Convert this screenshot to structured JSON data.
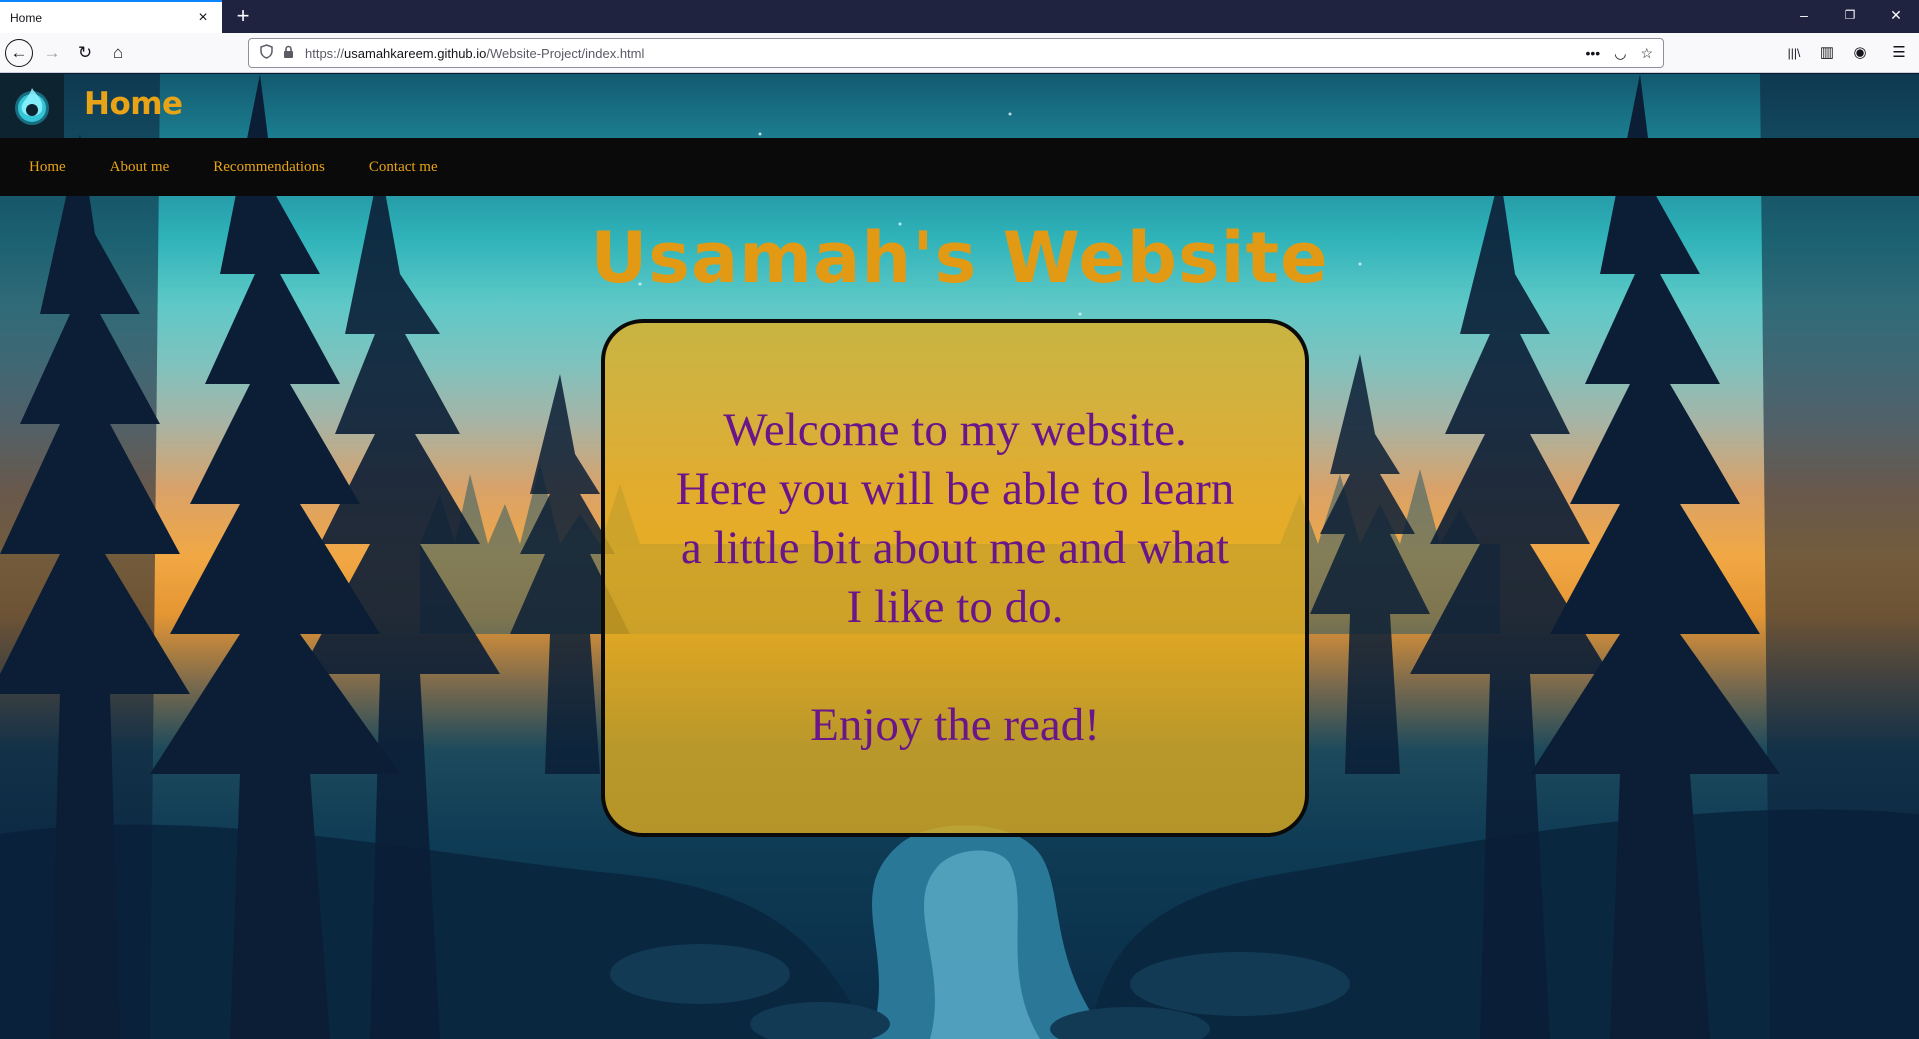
{
  "browser": {
    "tab_title": "Home",
    "tab_close": "×",
    "new_tab": "+",
    "url_prefix": "https://",
    "url_host": "usamahkareem.github.io",
    "url_path": "/Website-Project/index.html",
    "window_controls": {
      "minimize": "–",
      "restore": "❐",
      "close": "✕"
    },
    "nav": {
      "back": "←",
      "forward": "→",
      "reload": "↻",
      "home": "⌂"
    },
    "url_actions": {
      "more": "•••",
      "pocket": "◡",
      "bookmark": "☆"
    },
    "toolbar": {
      "library": "|||\\",
      "sidebar": "▥",
      "account": "◉",
      "menu": "☰"
    }
  },
  "site": {
    "header_title": "Home",
    "nav_links": [
      "Home",
      "About me",
      "Recommendations",
      "Contact me"
    ],
    "hero_title": "Usamah's Website",
    "welcome_lines": [
      "Welcome to my website.",
      "Here you will be able to learn",
      "a little bit about me and what",
      "I like to do."
    ],
    "closing_line": "Enjoy the read!"
  },
  "colors": {
    "accent_orange": "#e8a317",
    "card_fill": "#e4ae1c",
    "card_text_purple": "#6a168a",
    "nav_bar": "#0a0a0a",
    "browser_tab_accent": "#0a84ff"
  },
  "icons": {
    "logo": "flame-orb-logo",
    "shield": "tracking-protection-shield-icon",
    "lock": "padlock-icon"
  }
}
